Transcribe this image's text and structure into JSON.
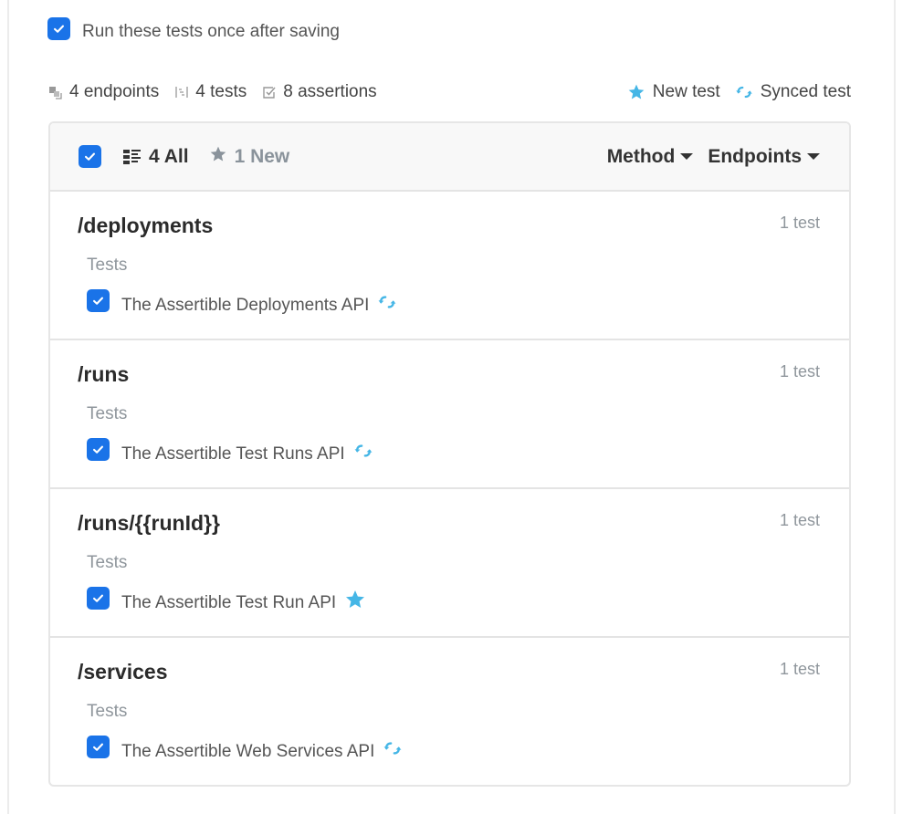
{
  "run_after_save": {
    "checked": true,
    "label": "Run these tests once after saving"
  },
  "stats": {
    "endpoints": {
      "icon": "endpoints-icon",
      "label": "4 endpoints"
    },
    "tests": {
      "icon": "tests-icon",
      "label": "4 tests"
    },
    "assertions": {
      "icon": "assertions-icon",
      "label": "8 assertions"
    }
  },
  "legend": {
    "new": {
      "icon": "star-icon",
      "label": "New test"
    },
    "synced": {
      "icon": "sync-icon",
      "label": "Synced test"
    }
  },
  "colors": {
    "checkbox": "#1a73e8",
    "accent_icon": "#45b6e6",
    "muted_text": "#8f969c"
  },
  "filter_bar": {
    "select_all_checked": true,
    "tabs": [
      {
        "icon": "list-icon",
        "label": "4 All",
        "active": true
      },
      {
        "icon": "star-icon",
        "label": "1 New",
        "active": false
      }
    ],
    "dropdowns": [
      {
        "label": "Method"
      },
      {
        "label": "Endpoints"
      }
    ]
  },
  "endpoints": [
    {
      "path": "/deployments",
      "count": "1 test",
      "tests_label": "Tests",
      "tests": [
        {
          "name": "The Assertible Deployments API",
          "checked": true,
          "status": "synced"
        }
      ]
    },
    {
      "path": "/runs",
      "count": "1 test",
      "tests_label": "Tests",
      "tests": [
        {
          "name": "The Assertible Test Runs API",
          "checked": true,
          "status": "synced"
        }
      ]
    },
    {
      "path": "/runs/{{runId}}",
      "count": "1 test",
      "tests_label": "Tests",
      "tests": [
        {
          "name": "The Assertible Test Run API",
          "checked": true,
          "status": "new"
        }
      ]
    },
    {
      "path": "/services",
      "count": "1 test",
      "tests_label": "Tests",
      "tests": [
        {
          "name": "The Assertible Web Services API",
          "checked": true,
          "status": "synced"
        }
      ]
    }
  ]
}
